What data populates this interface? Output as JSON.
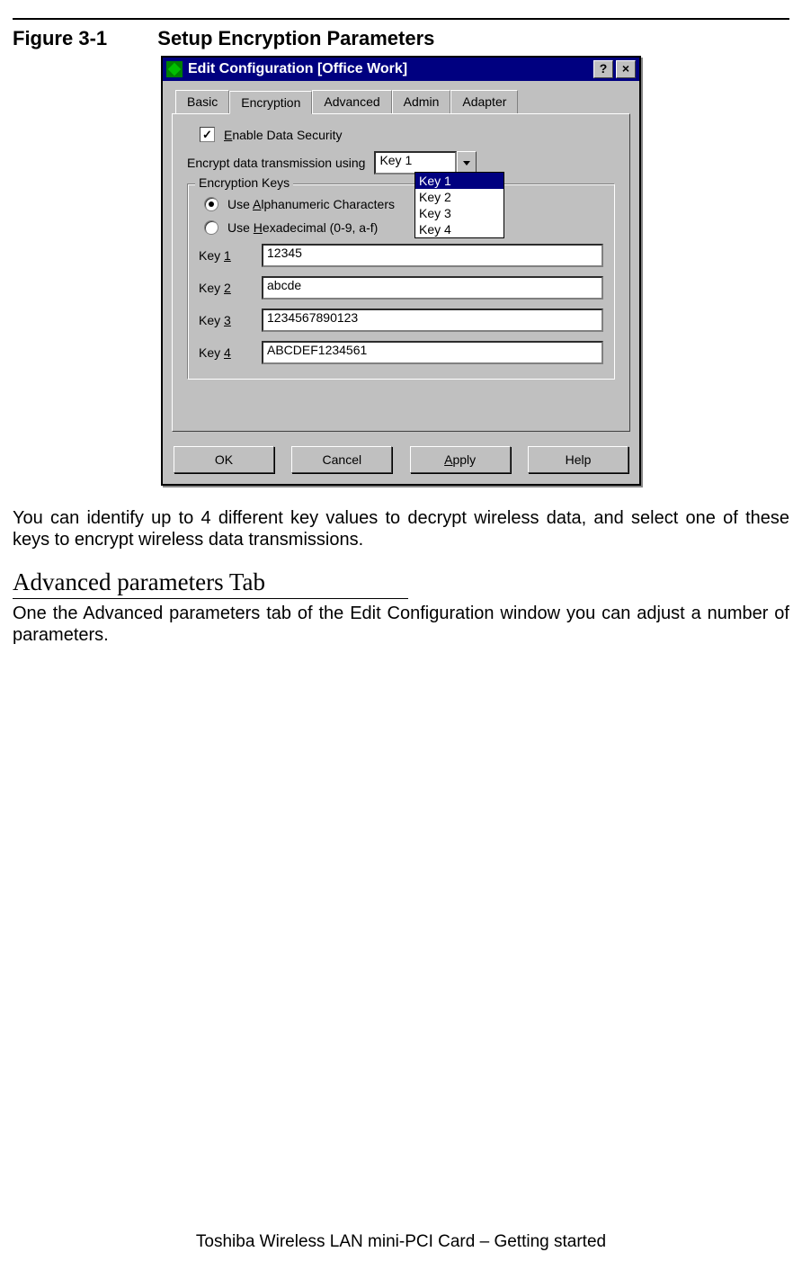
{
  "figure": {
    "number": "Figure 3-1",
    "title": "Setup Encryption Parameters"
  },
  "dialog": {
    "title": "Edit Configuration [Office Work]",
    "help_btn": "?",
    "close_btn": "×",
    "tabs": [
      "Basic",
      "Encryption",
      "Advanced",
      "Admin",
      "Adapter"
    ],
    "active_tab": 1,
    "enable_label_pre": "E",
    "enable_label": "nable Data Security",
    "encrypt_using_label": "Encrypt data transmission using",
    "combo_value": "Key 1",
    "dropdown_options": [
      "Key 1",
      "Key 2",
      "Key 3",
      "Key 4"
    ],
    "dropdown_sel": 0,
    "groupbox_legend": "Encryption Keys",
    "radio_alpha_pre": "Use ",
    "radio_alpha_u": "A",
    "radio_alpha_post": "lphanumeric Characters",
    "radio_hex_pre": "Use ",
    "radio_hex_u": "H",
    "radio_hex_post": "exadecimal (0-9, a-f)",
    "keys": [
      {
        "label_pre": "Key ",
        "label_u": "1",
        "value": "12345"
      },
      {
        "label_pre": "Key ",
        "label_u": "2",
        "value": "abcde"
      },
      {
        "label_pre": "Key ",
        "label_u": "3",
        "value": "1234567890123"
      },
      {
        "label_pre": "Key ",
        "label_u": "4",
        "value": "ABCDEF1234561"
      }
    ],
    "buttons": {
      "ok": "OK",
      "cancel": "Cancel",
      "apply_u": "A",
      "apply_post": "pply",
      "help": "Help"
    }
  },
  "para1": "You can identify up to 4 different key values to decrypt wireless data, and select one of these keys to encrypt wireless data transmissions.",
  "section_title": "Advanced parameters Tab",
  "para2": "One the Advanced parameters tab of the Edit Configuration window you can adjust a number of parameters.",
  "footer": "Toshiba Wireless LAN mini-PCI Card – Getting started"
}
